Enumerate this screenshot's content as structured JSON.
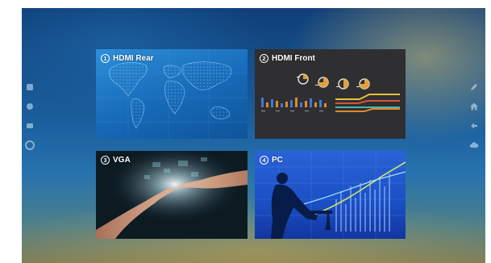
{
  "sources": [
    {
      "id": "hdmi-rear",
      "number": "1",
      "label": "HDMI Rear",
      "preview": "world-map"
    },
    {
      "id": "hdmi-front",
      "number": "2",
      "label": "HDMI Front",
      "preview": "infographic"
    },
    {
      "id": "vga",
      "number": "3",
      "label": "VGA",
      "preview": "reaching-hands"
    },
    {
      "id": "pc",
      "number": "4",
      "label": "PC",
      "preview": "business-silhouette"
    }
  ],
  "left_dock_icons": [
    "dock-icon-1",
    "dock-icon-2",
    "dock-icon-3",
    "dock-icon-4"
  ],
  "right_dock_icons": [
    "pencil-icon",
    "home-icon",
    "back-icon",
    "cloud-icon"
  ],
  "colors": {
    "tile_label": "#ffffff",
    "front_bar_blue": "#3c7bd8",
    "front_bar_orange": "#e08a2a",
    "front_stripe_yellow": "#e3c33a",
    "front_stripe_red": "#d9553a",
    "front_stripe_teal": "#4db6a8"
  }
}
